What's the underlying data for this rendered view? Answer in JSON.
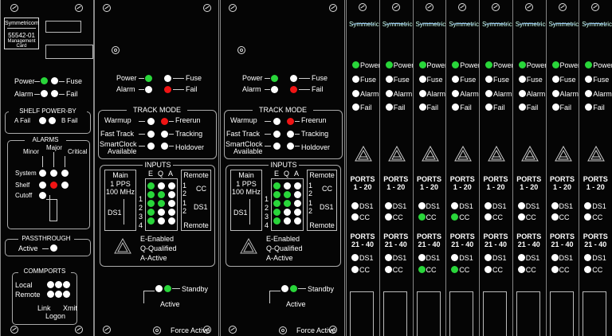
{
  "mgmt": {
    "logo": "Symmetricom",
    "model": "55542-01",
    "card_name_1": "Management",
    "card_name_2": "Card",
    "power_label": "Power",
    "fuse_label": "Fuse",
    "alarm_label": "Alarm",
    "fail_label": "Fail",
    "shelf_power_title": "SHELF POWER-BY",
    "a_fail": "A Fail",
    "b_fail": "B Fail",
    "alarms_title": "ALARMS",
    "minor": "Minor",
    "major": "Major",
    "critical": "Critical",
    "system": "System",
    "shelf": "Shelf",
    "cutoff": "Cutoff",
    "passthrough_title": "PASSTHROUGH",
    "active": "Active",
    "commports_title": "COMMPORTS",
    "local": "Local",
    "remote": "Remote",
    "link": "Link",
    "xmit": "Xmit",
    "logon": "Logon"
  },
  "clock_card": {
    "power": "Power",
    "fuse": "Fuse",
    "alarm": "Alarm",
    "fail": "Fail",
    "track_mode_title": "TRACK MODE",
    "warmup": "Warmup",
    "freerun": "Freerun",
    "fast_track": "Fast Track",
    "tracking": "Tracking",
    "smartclock_1": "SmartClock",
    "smartclock_2": "Available",
    "holdover": "Holdover",
    "inputs_title": "INPUTS",
    "main_1": "Main",
    "main_2": "1 PPS",
    "main_3": "100 MHz",
    "ds1": "DS1",
    "col_e": "E",
    "col_q": "Q",
    "col_a": "A",
    "n1": "1",
    "n2": "2",
    "n3": "3",
    "n4": "4",
    "remote": "Remote",
    "cc": "CC",
    "remote_ds1": "DS1",
    "legend_e": "E-Enabled",
    "legend_q": "Q-Qualified",
    "legend_a": "A-Active",
    "standby": "Standby",
    "active": "Active",
    "force_active": "Force Active"
  },
  "output_card": {
    "logo": "Symmetricom",
    "power": "Power",
    "fuse": "Fuse",
    "alarm": "Alarm",
    "fail": "Fail",
    "ports_title": "PORTS",
    "ports_range_1": "1 - 20",
    "ports_range_2": "21 - 40",
    "ds1": "DS1",
    "cc": "CC"
  },
  "colors": {
    "led_green": "#29d63a",
    "led_red": "#f01414",
    "led_white": "#ffffff",
    "background": "#000000"
  }
}
